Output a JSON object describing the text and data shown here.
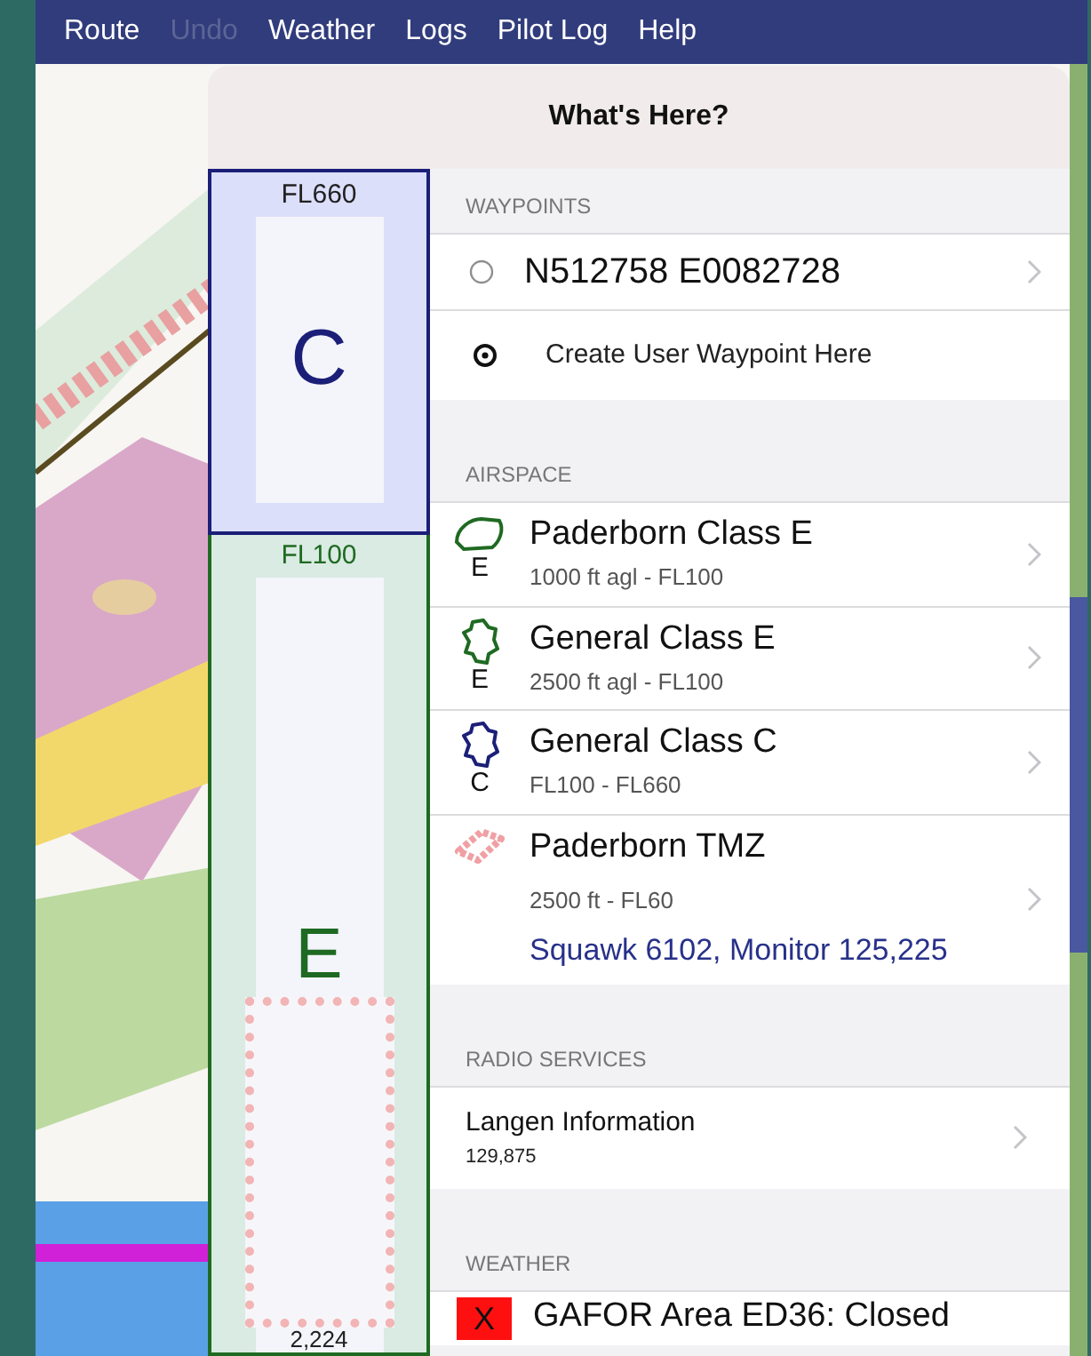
{
  "menu": [
    {
      "label": "Route",
      "disabled": false
    },
    {
      "label": "Undo",
      "disabled": true
    },
    {
      "label": "Weather",
      "disabled": false
    },
    {
      "label": "Logs",
      "disabled": false
    },
    {
      "label": "Pilot Log",
      "disabled": false
    },
    {
      "label": "Help",
      "disabled": false
    }
  ],
  "popover": {
    "title": "What's Here?"
  },
  "profile": {
    "segments": [
      {
        "top_label": "FL660",
        "letter": "C",
        "color": "#1b1f78"
      },
      {
        "top_label": "FL100",
        "letter": "E",
        "color": "#1f6a22"
      }
    ],
    "bottom_label": "2,224"
  },
  "sections": [
    {
      "title": "WAYPOINTS",
      "rows": [
        {
          "kind": "waypoint",
          "name": "N512758 E0082728"
        },
        {
          "kind": "action",
          "name": "Create User Waypoint Here"
        }
      ]
    },
    {
      "title": "AIRSPACE",
      "rows": [
        {
          "kind": "airspace",
          "icon": {
            "kind": "region",
            "color": "#1f6a22"
          },
          "letter": "E",
          "name": "Paderborn Class E",
          "altitudes": "1000 ft agl - FL100"
        },
        {
          "kind": "airspace",
          "icon": {
            "kind": "country",
            "color": "#1f6a22"
          },
          "letter": "E",
          "name": "General Class E",
          "altitudes": "2500 ft agl - FL100"
        },
        {
          "kind": "airspace",
          "icon": {
            "kind": "country",
            "color": "#1b1f78"
          },
          "letter": "C",
          "name": "General Class C",
          "altitudes": "FL100 - FL660"
        },
        {
          "kind": "airspace",
          "icon": {
            "kind": "tmz",
            "color": "#f0a0a4"
          },
          "name": "Paderborn TMZ",
          "altitudes": "2500 ft - FL60",
          "note": "Squawk 6102, Monitor 125,225"
        }
      ]
    },
    {
      "title": "RADIO SERVICES",
      "rows": [
        {
          "kind": "radio",
          "name": "Langen Information",
          "frequency": "129,875"
        }
      ]
    },
    {
      "title": "WEATHER",
      "rows": [
        {
          "kind": "weather",
          "badge": "X",
          "name": "GAFOR Area ED36: Closed"
        }
      ]
    }
  ]
}
